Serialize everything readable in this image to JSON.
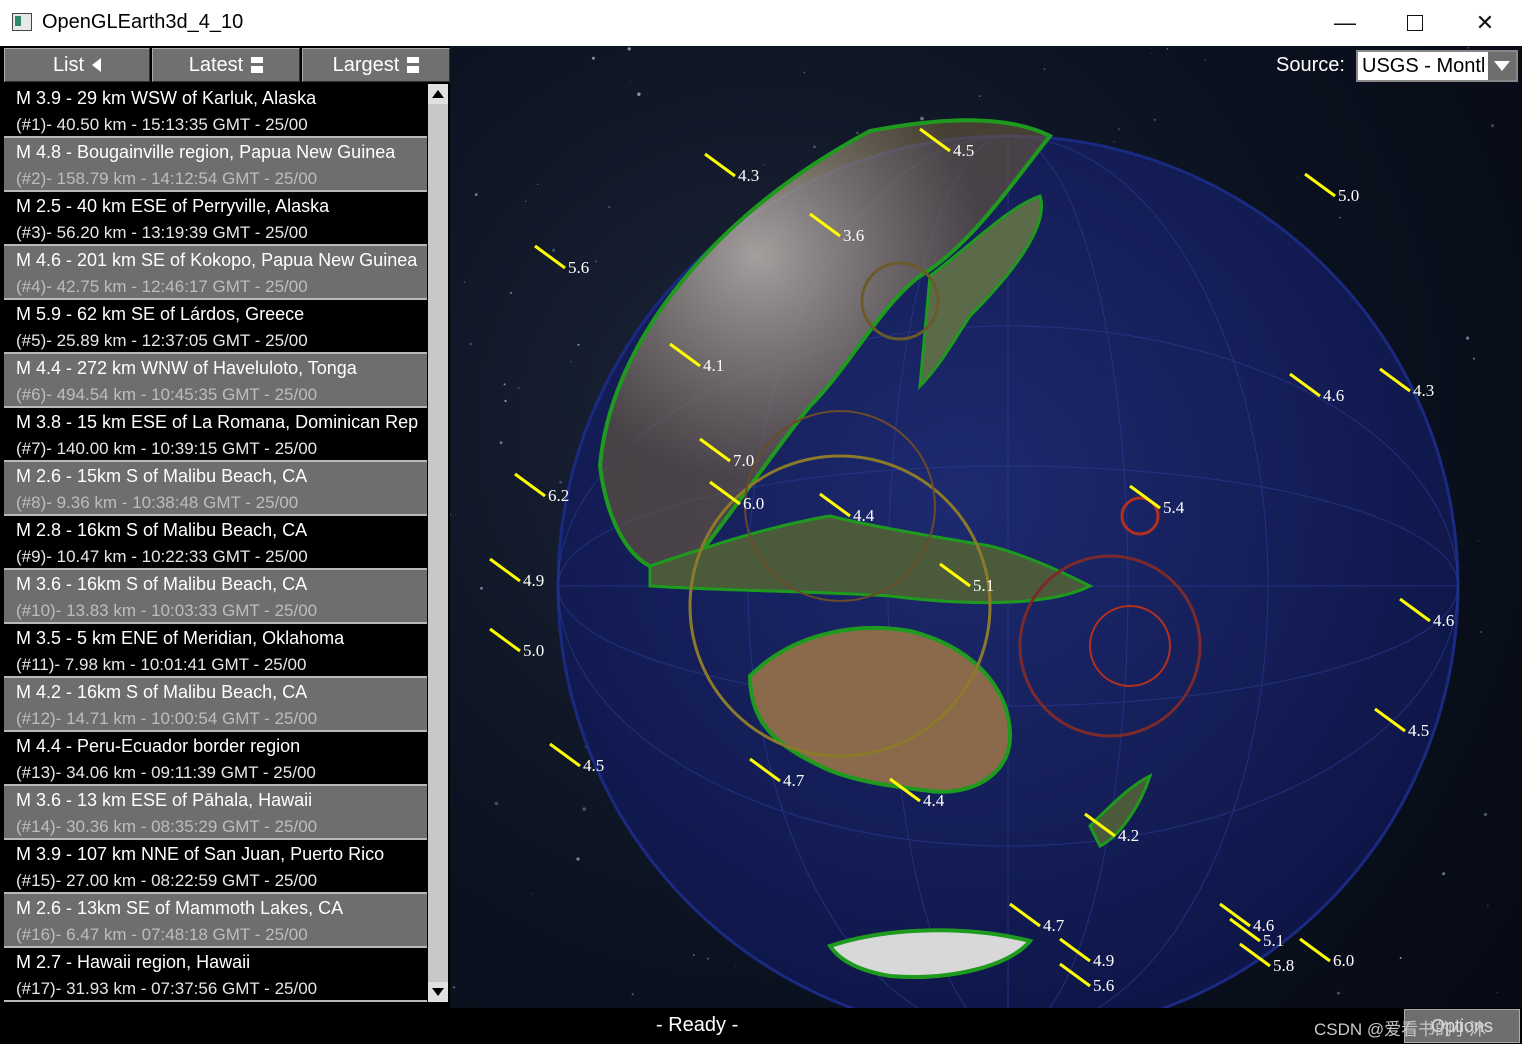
{
  "window": {
    "title": "OpenGLEarth3d_4_10",
    "minimize_glyph": "—",
    "close_glyph": "✕"
  },
  "tabs": [
    {
      "label": "List",
      "icon": "triangle-left-icon"
    },
    {
      "label": "Latest",
      "icon": "doc-icon"
    },
    {
      "label": "Largest",
      "icon": "doc-icon"
    }
  ],
  "source": {
    "label": "Source:",
    "value": "USGS - Montl"
  },
  "quakes": [
    {
      "title": "M 3.9 - 29 km WSW of Karluk, Alaska",
      "detail": "(#1)- 40.50 km - 15:13:35 GMT - 25/00"
    },
    {
      "title": "M 4.8 - Bougainville region, Papua New Guinea",
      "detail": "(#2)- 158.79 km - 14:12:54 GMT - 25/00"
    },
    {
      "title": "M 2.5 - 40 km ESE of Perryville, Alaska",
      "detail": "(#3)- 56.20 km - 13:19:39 GMT - 25/00"
    },
    {
      "title": "M 4.6 - 201 km SE of Kokopo, Papua New Guinea",
      "detail": "(#4)- 42.75 km - 12:46:17 GMT - 25/00"
    },
    {
      "title": "M 5.9 - 62 km SE of Lárdos, Greece",
      "detail": "(#5)- 25.89 km - 12:37:05 GMT - 25/00"
    },
    {
      "title": "M 4.4 - 272 km WNW of Haveluloto, Tonga",
      "detail": "(#6)- 494.54 km - 10:45:35 GMT - 25/00"
    },
    {
      "title": "M 3.8 - 15 km ESE of La Romana, Dominican Rep",
      "detail": "(#7)- 140.00 km - 10:39:15 GMT - 25/00"
    },
    {
      "title": "M 2.6 - 15km S of Malibu Beach, CA",
      "detail": "(#8)- 9.36 km - 10:38:48 GMT - 25/00"
    },
    {
      "title": "M 2.8 - 16km S of Malibu Beach, CA",
      "detail": "(#9)- 10.47 km - 10:22:33 GMT - 25/00"
    },
    {
      "title": "M 3.6 - 16km S of Malibu Beach, CA",
      "detail": "(#10)- 13.83 km - 10:03:33 GMT - 25/00"
    },
    {
      "title": "M 3.5 - 5 km ENE of Meridian, Oklahoma",
      "detail": "(#11)- 7.98 km - 10:01:41 GMT - 25/00"
    },
    {
      "title": "M 4.2 - 16km S of Malibu Beach, CA",
      "detail": "(#12)- 14.71 km - 10:00:54 GMT - 25/00"
    },
    {
      "title": "M 4.4 - Peru-Ecuador border region",
      "detail": "(#13)- 34.06 km - 09:11:39 GMT - 25/00"
    },
    {
      "title": "M 3.6 - 13 km ESE of Pāhala, Hawaii",
      "detail": "(#14)- 30.36 km - 08:35:29 GMT - 25/00"
    },
    {
      "title": "M 3.9 - 107 km NNE of San Juan, Puerto Rico",
      "detail": "(#15)- 27.00 km - 08:22:59 GMT - 25/00"
    },
    {
      "title": "M 2.6 - 13km SE of Mammoth Lakes, CA",
      "detail": "(#16)- 6.47 km - 07:48:18 GMT - 25/00"
    },
    {
      "title": "M 2.7 - Hawaii region, Hawaii",
      "detail": "(#17)- 31.93 km - 07:37:56 GMT - 25/00"
    }
  ],
  "globe_labels": [
    "7.0",
    "6.2",
    "6.0",
    "5.4",
    "5.1",
    "5.0",
    "4.9",
    "4.5",
    "4.6",
    "5.6",
    "4.4",
    "4.7",
    "5.8",
    "6.0",
    "5.1",
    "4.6",
    "4.5",
    "4.3",
    "4.2",
    "4.7",
    "4.4",
    "4.9",
    "5.6",
    "4.6",
    "5.0",
    "4.5",
    "4.1",
    "3.6",
    "4.3"
  ],
  "status": {
    "text": "- Ready -",
    "options_label": "Options",
    "watermark": "CSDN @爱看书的小沐"
  },
  "colors": {
    "ocean": "#14205a",
    "land": "#6b5a3c",
    "coast": "#1e9a1e",
    "marker": "#ffff00",
    "ring": "#b03020"
  }
}
